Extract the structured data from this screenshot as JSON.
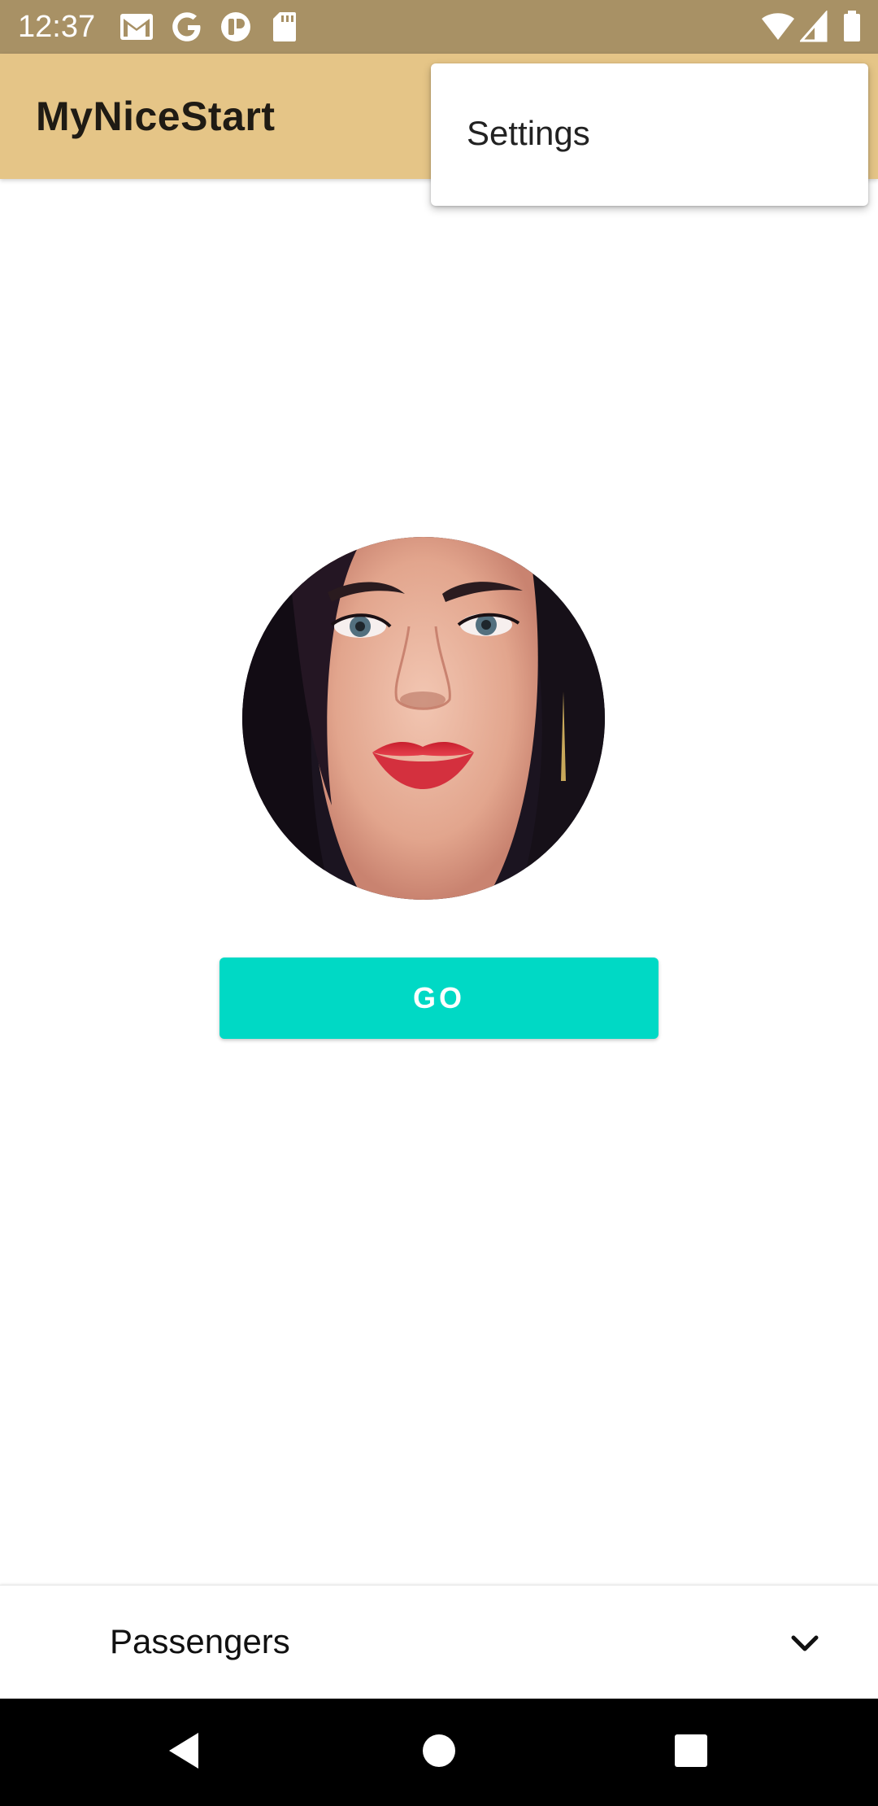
{
  "status_bar": {
    "time": "12:37",
    "icons_left": [
      "gmail-icon",
      "google-icon",
      "app-notification-icon",
      "sd-card-icon"
    ],
    "icons_right": [
      "wifi-icon",
      "cell-signal-icon",
      "battery-icon"
    ]
  },
  "app_bar": {
    "title": "MyNiceStart"
  },
  "overflow_menu": {
    "items": [
      {
        "label": "Settings"
      }
    ]
  },
  "main": {
    "avatar_icon": "profile-photo",
    "go_button_label": "GO"
  },
  "spinner": {
    "selected": "Passengers"
  },
  "nav_bar": {
    "buttons": [
      "back-icon",
      "home-icon",
      "recents-icon"
    ]
  },
  "colors": {
    "status_bar": "#a89165",
    "app_bar": "#e5c587",
    "accent": "#00d9c5",
    "nav_bar": "#000000"
  }
}
